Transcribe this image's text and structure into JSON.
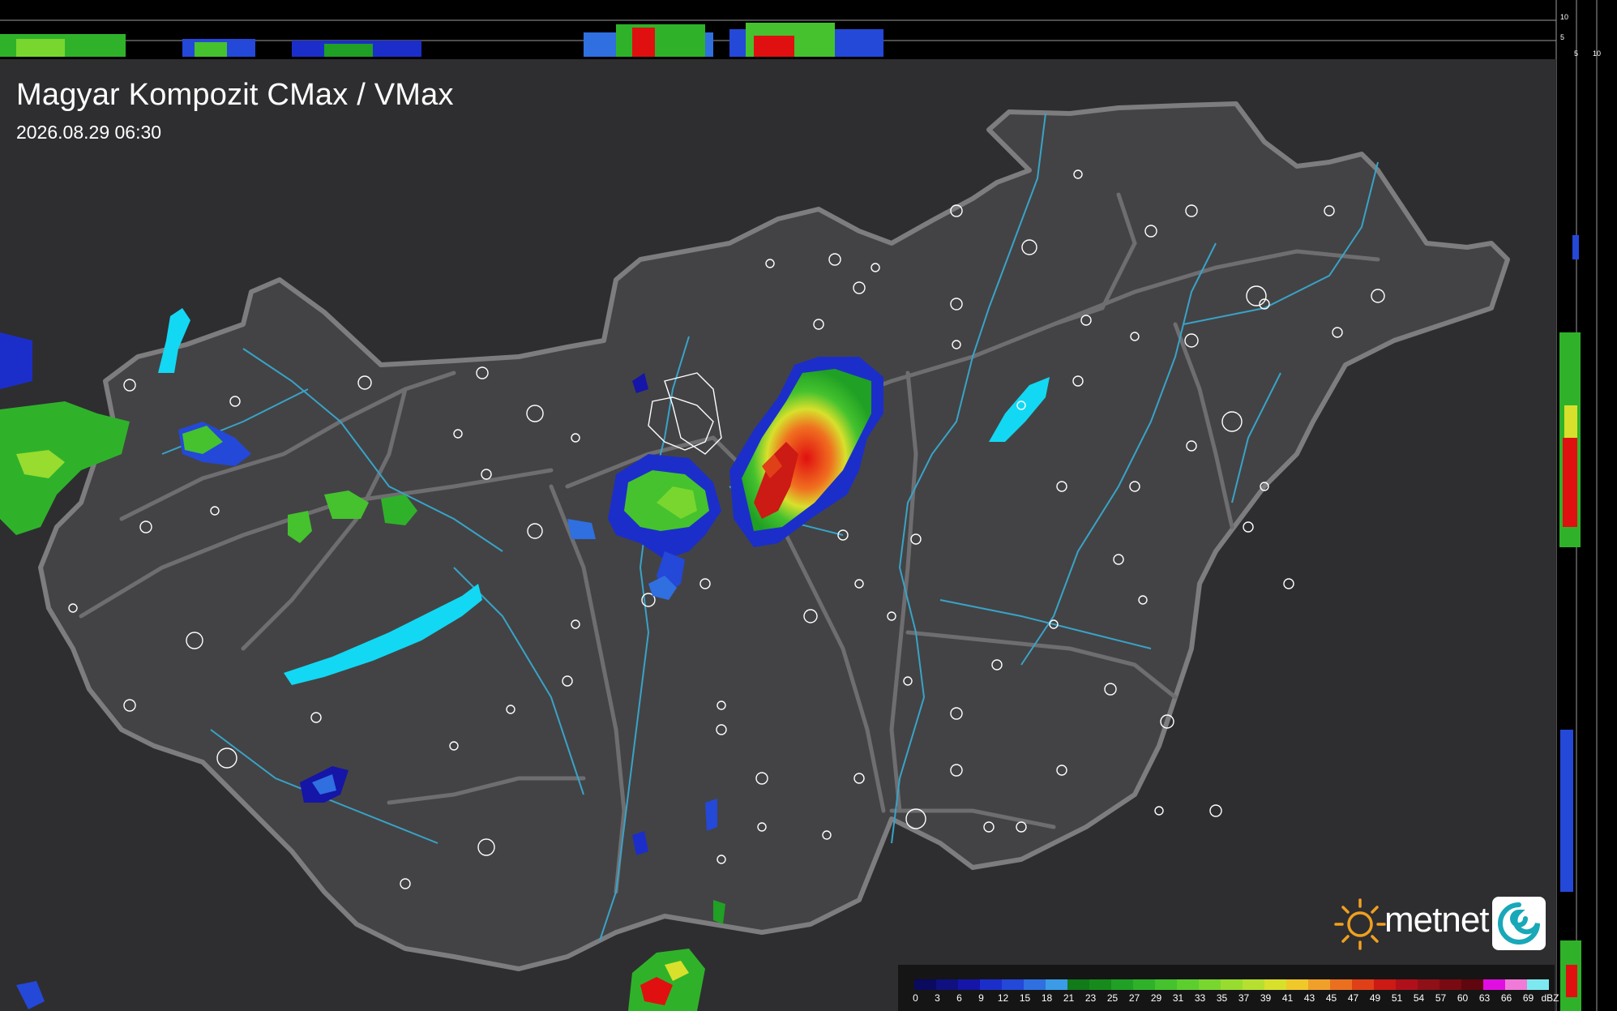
{
  "title": "Magyar Kompozit CMax / VMax",
  "timestamp": "2026.08.29 06:30",
  "brand": {
    "name": "metnet"
  },
  "colors": {
    "background": "#2e2e30",
    "country_fill": "#434345",
    "border": "#7d7d80",
    "rivers": "#39a3c8",
    "lakes": "#12d8f4",
    "towns": "#ffffff"
  },
  "cross_section": {
    "top_scale": [
      "10",
      "5"
    ],
    "side_scale": [
      "5",
      "10"
    ]
  },
  "legend": {
    "unit": "dBZ",
    "levels": [
      "0",
      "3",
      "6",
      "9",
      "12",
      "15",
      "18",
      "21",
      "23",
      "25",
      "27",
      "29",
      "31",
      "33",
      "35",
      "37",
      "39",
      "41",
      "43",
      "45",
      "47",
      "49",
      "51",
      "54",
      "57",
      "60",
      "63",
      "66",
      "69"
    ],
    "colors": [
      "#0a0a5e",
      "#101080",
      "#1515a8",
      "#1c2ec9",
      "#2448d8",
      "#2f6fe0",
      "#3b9be6",
      "#117a19",
      "#178a1c",
      "#20a024",
      "#2fb22a",
      "#45c22e",
      "#5ccf2f",
      "#79d62f",
      "#98dc2f",
      "#b5e030",
      "#d8e02c",
      "#f0c82a",
      "#f0a02a",
      "#ea7020",
      "#e04018",
      "#cc1a14",
      "#b0101a",
      "#901018",
      "#7a0a12",
      "#60060e",
      "#e00ee0",
      "#f07ad8",
      "#7ee8f0"
    ]
  }
}
